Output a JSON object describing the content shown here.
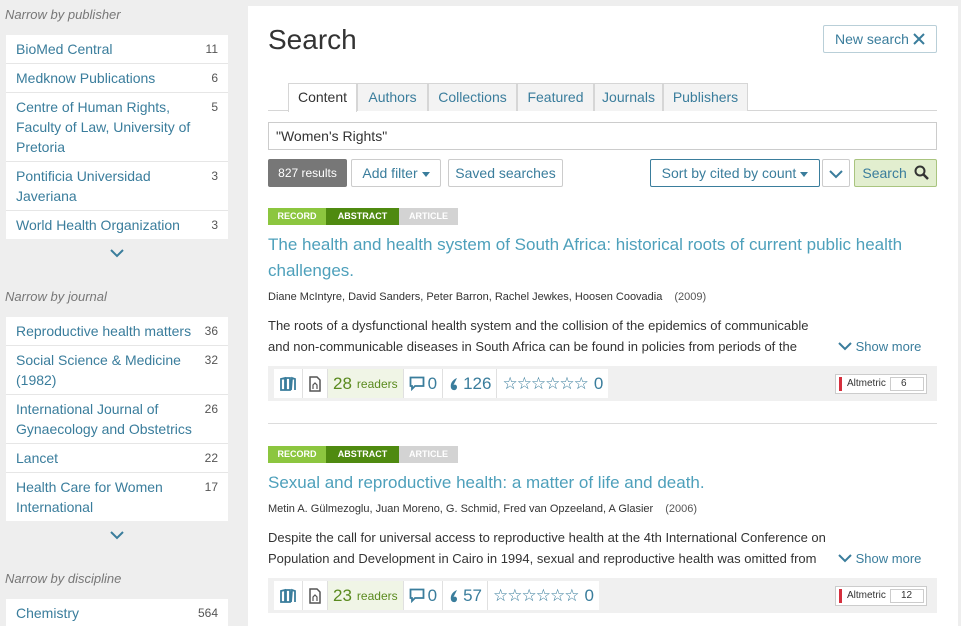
{
  "sidebar": {
    "publisher": {
      "title": "Narrow by publisher",
      "items": [
        {
          "label": "BioMed Central",
          "count": "11"
        },
        {
          "label": "Medknow Publications",
          "count": "6"
        },
        {
          "label": "Centre of Human Rights, Faculty of Law, University of Pretoria",
          "count": "5"
        },
        {
          "label": "Pontificia Universidad Javeriana",
          "count": "3"
        },
        {
          "label": "World Health Organization",
          "count": "3"
        }
      ]
    },
    "journal": {
      "title": "Narrow by journal",
      "items": [
        {
          "label": "Reproductive health matters",
          "count": "36"
        },
        {
          "label": "Social Science & Medicine (1982)",
          "count": "32"
        },
        {
          "label": "International Journal of Gynaecology and Obstetrics",
          "count": "26"
        },
        {
          "label": "Lancet",
          "count": "22"
        },
        {
          "label": "Health Care for Women International",
          "count": "17"
        }
      ]
    },
    "discipline": {
      "title": "Narrow by discipline",
      "items": [
        {
          "label": "Chemistry",
          "count": "564"
        }
      ]
    }
  },
  "header": {
    "title": "Search",
    "new_search_label": "New search"
  },
  "tabs": [
    {
      "label": "Content",
      "active": true
    },
    {
      "label": "Authors"
    },
    {
      "label": "Collections"
    },
    {
      "label": "Featured"
    },
    {
      "label": "Journals"
    },
    {
      "label": "Publishers"
    }
  ],
  "search": {
    "query": "\"Women's Rights\""
  },
  "toolbar": {
    "results_count": "827 results",
    "add_filter_label": "Add filter",
    "saved_searches_label": "Saved searches",
    "sort_label": "Sort by cited by count",
    "search_label": "Search"
  },
  "colors": {
    "accent": "#3a7d9c",
    "title_link": "#4ea0bb",
    "record_badge": "#8cc63f",
    "abstract_badge": "#4f8a10",
    "article_badge": "#d3d3d3"
  },
  "results": [
    {
      "badges": [
        "RECORD",
        "ABSTRACT",
        "ARTICLE"
      ],
      "title": "The health and health system of South Africa: historical roots of current public health challenges.",
      "authors": "Diane McIntyre, David Sanders, Peter Barron, Rachel Jewkes, Hoosen Coovadia",
      "year": "(2009)",
      "abstract": "The roots of a dysfunctional health system and the collision of the epidemics of communicable and non-communicable diseases in South Africa can be found in policies from periods of the country's",
      "show_more": "Show more",
      "readers": "28",
      "readers_label": "readers",
      "comments": "0",
      "citations": "126",
      "rating": "0",
      "altmetric_label": "Altmetric",
      "altmetric_score": "6"
    },
    {
      "badges": [
        "RECORD",
        "ABSTRACT",
        "ARTICLE"
      ],
      "title": "Sexual and reproductive health: a matter of life and death.",
      "authors": "Metin A. Gülmezoglu, Juan Moreno, G. Schmid, Fred van Opzeeland, A Glasier",
      "year": "(2006)",
      "abstract": "Despite the call for universal access to reproductive health at the 4th International Conference on Population and Development in Cairo in 1994, sexual and reproductive health was omitted from the",
      "show_more": "Show more",
      "readers": "23",
      "readers_label": "readers",
      "comments": "0",
      "citations": "57",
      "rating": "0",
      "altmetric_label": "Altmetric",
      "altmetric_score": "12"
    }
  ]
}
